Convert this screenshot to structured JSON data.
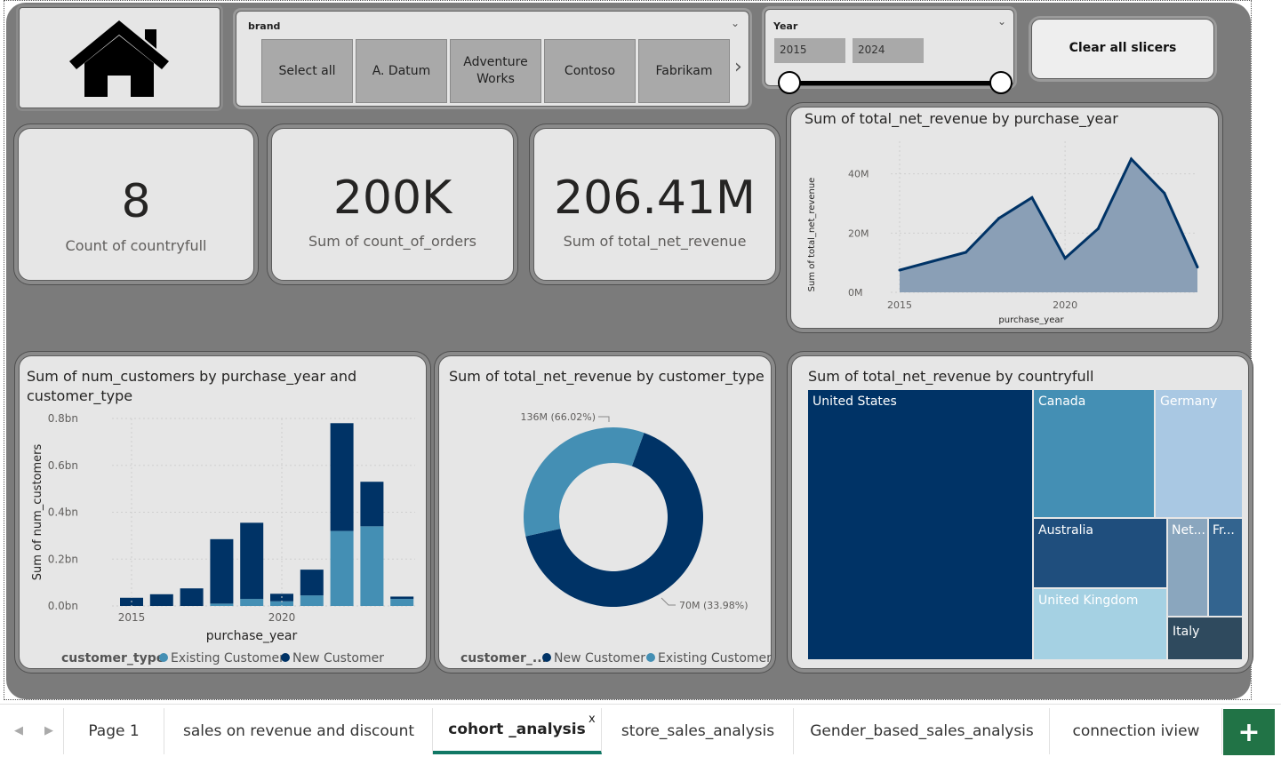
{
  "brand_slicer": {
    "title": "brand",
    "items": [
      "Select all",
      "A. Datum",
      "Adventure Works",
      "Contoso",
      "Fabrikam"
    ]
  },
  "year_slicer": {
    "title": "Year",
    "start": "2015",
    "end": "2024"
  },
  "clear_button": {
    "label": "Clear all slicers"
  },
  "kpis": [
    {
      "value": "8",
      "label": "Count of countryfull"
    },
    {
      "value": "200K",
      "label": "Sum of count_of_orders"
    },
    {
      "value": "206.41M",
      "label": "Sum of total_net_revenue"
    }
  ],
  "area_chart": {
    "title": "Sum of total_net_revenue by purchase_year",
    "ylabel": "Sum of total_net_revenue",
    "xlabel": "purchase_year",
    "yticks": [
      "0M",
      "20M",
      "40M"
    ],
    "xticks": [
      "2015",
      "2020"
    ]
  },
  "bar_chart": {
    "title_line1": "Sum of num_customers by purchase_year and",
    "title_line2": "customer_type",
    "ylabel": "Sum of num_customers",
    "xlabel": "purchase_year",
    "yticks": [
      "0.0bn",
      "0.2bn",
      "0.4bn",
      "0.6bn",
      "0.8bn"
    ],
    "xticks": [
      "2015",
      "2020"
    ],
    "legend_title": "customer_type",
    "legend_items": [
      "Existing Customer",
      "New Customer"
    ]
  },
  "donut_chart": {
    "title": "Sum of total_net_revenue by customer_type",
    "label_new": "136M (66.02%)",
    "label_existing": "70M (33.98%)",
    "legend_title": "customer_...",
    "legend_items": [
      "New Customer",
      "Existing Customer"
    ]
  },
  "treemap": {
    "title": "Sum of total_net_revenue by countryfull",
    "labels": [
      "United States",
      "Canada",
      "Germany",
      "Australia",
      "United Kingdom",
      "Net...",
      "Fr...",
      "Italy"
    ]
  },
  "tabs": [
    "Page 1",
    "sales on revenue and discount",
    "cohort _analysis",
    "store_sales_analysis",
    "Gender_based_sales_analysis",
    "connection iview"
  ],
  "tab_close": "x",
  "colors": {
    "dark_blue": "#003366",
    "mid_blue": "#448fb4",
    "light_blue": "#a9c8e3",
    "report_bg": "#7b7b7b",
    "accent_green": "#217346"
  },
  "chart_data": [
    {
      "type": "area",
      "title": "Sum of total_net_revenue by purchase_year",
      "xlabel": "purchase_year",
      "ylabel": "Sum of total_net_revenue",
      "x": [
        2015,
        2016,
        2017,
        2018,
        2019,
        2020,
        2021,
        2022,
        2023,
        2024
      ],
      "values": [
        7.5,
        10.5,
        13.5,
        25,
        32,
        11.5,
        21.5,
        45,
        33.5,
        8.5
      ],
      "ylim": [
        0,
        45
      ],
      "unit": "M"
    },
    {
      "type": "bar",
      "stacked": true,
      "title": "Sum of num_customers by purchase_year and customer_type",
      "xlabel": "purchase_year",
      "ylabel": "Sum of num_customers",
      "x": [
        2015,
        2016,
        2017,
        2018,
        2019,
        2020,
        2021,
        2022,
        2023,
        2024
      ],
      "series": [
        {
          "name": "Existing Customer",
          "values": [
            0.0,
            0.0,
            0.0,
            0.01,
            0.03,
            0.02,
            0.045,
            0.32,
            0.34,
            0.03
          ]
        },
        {
          "name": "New Customer",
          "values": [
            0.035,
            0.05,
            0.075,
            0.275,
            0.325,
            0.032,
            0.11,
            0.46,
            0.19,
            0.01
          ]
        }
      ],
      "ylim": [
        0,
        0.8
      ],
      "unit": "bn"
    },
    {
      "type": "pie",
      "donut": true,
      "title": "Sum of total_net_revenue by customer_type",
      "categories": [
        "New Customer",
        "Existing Customer"
      ],
      "values": [
        136,
        70
      ],
      "percentages": [
        66.02,
        33.98
      ]
    },
    {
      "type": "treemap",
      "title": "Sum of total_net_revenue by countryfull",
      "categories": [
        "United States",
        "Canada",
        "Germany",
        "Australia",
        "United Kingdom",
        "Net...",
        "Fr...",
        "Italy"
      ],
      "values": [
        90,
        24.5,
        19.5,
        16,
        13.5,
        6.5,
        5.5,
        5
      ]
    }
  ]
}
